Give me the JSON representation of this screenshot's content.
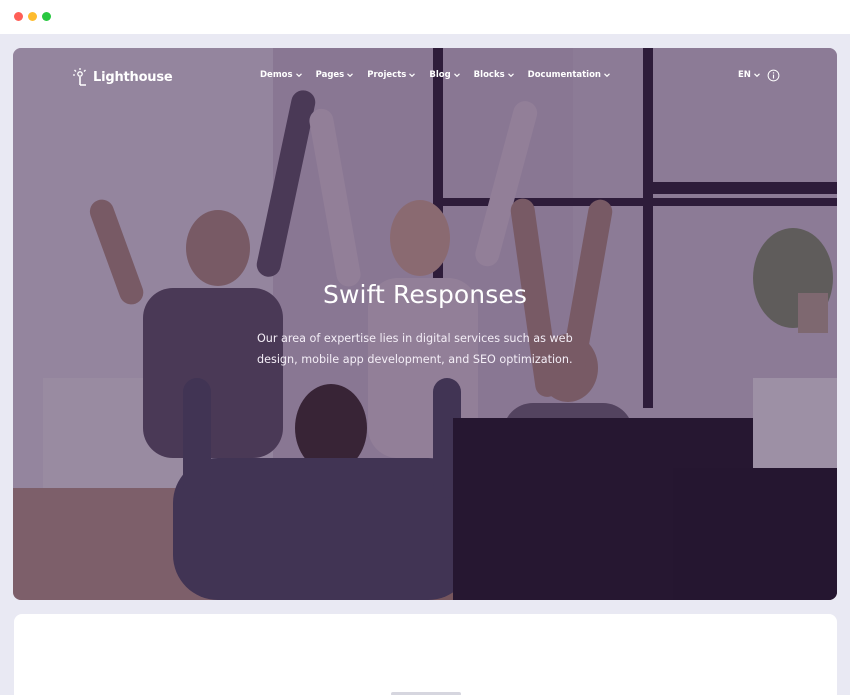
{
  "window": {
    "controls": [
      "close",
      "minimize",
      "maximize"
    ],
    "colors": {
      "close": "#ff5f57",
      "minimize": "#febc2e",
      "maximize": "#28c840"
    }
  },
  "nav": {
    "logo_text": "Lighthouse",
    "logo_icon": "lighthouse-sun-icon",
    "menu": [
      {
        "label": "Demos",
        "icon": "chevron-down-icon"
      },
      {
        "label": "Pages",
        "icon": "chevron-down-icon"
      },
      {
        "label": "Projects",
        "icon": "chevron-down-icon"
      },
      {
        "label": "Blog",
        "icon": "chevron-down-icon"
      },
      {
        "label": "Blocks",
        "icon": "chevron-down-icon"
      },
      {
        "label": "Documentation",
        "icon": "chevron-down-icon"
      }
    ],
    "language": "EN",
    "info_icon": "info-icon"
  },
  "hero": {
    "title": "Swift Responses",
    "text": "Our area of expertise lies in digital services such as web design, mobile app development, and SEO optimization.",
    "overlay_color": "#341c44"
  }
}
